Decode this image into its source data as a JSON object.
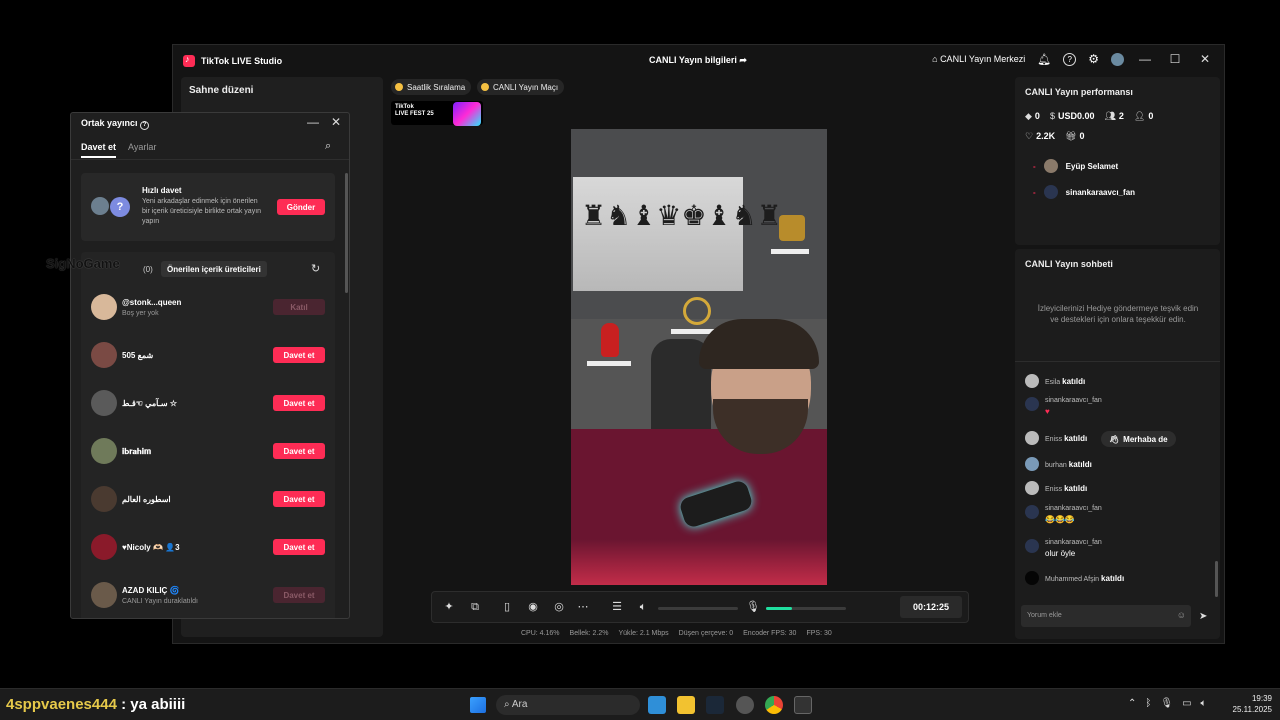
{
  "window": {
    "app_name": "TikTok LIVE Studio",
    "live_info": "CANLI Yayın bilgileri",
    "live_center": "CANLI Yayın Merkezi",
    "minimize": "—",
    "maximize": "☐",
    "close": "✕"
  },
  "left_panel": {
    "title": "Sahne düzeni"
  },
  "stage": {
    "chip_hourly": "Saatlik Sıralama",
    "chip_match": "CANLI Yayın Maçı",
    "livefest_line1": "TikTok",
    "livefest_line2": "LIVE FEST 25"
  },
  "controls": {
    "timer": "00:12:25",
    "volume_level": 0,
    "mic_level": 0.32
  },
  "stats": {
    "cpu": "CPU:  4.16%",
    "memory": "Bellek:  2.2%",
    "upload": "Yükle:  2.1 Mbps",
    "dropped": "Düşen çerçeve:  0",
    "encoder_fps": "Encoder FPS:  30",
    "fps": "FPS:  30"
  },
  "performance": {
    "title": "CANLI Yayın performansı",
    "diamonds": "0",
    "usd": "USD0.00",
    "viewers": "2",
    "new_followers": "0",
    "likes": "2.2K",
    "gifts": "0",
    "viewer_list": [
      "Eyüp Selamet",
      "sinankaraavcı_fan"
    ]
  },
  "chat": {
    "title": "CANLI Yayın sohbeti",
    "empty_text": "İzleyicilerinizi Hediye göndermeye teşvik edin ve destekleri için onlara teşekkür edin.",
    "joined": "katıldı",
    "messages": [
      {
        "user": "Esila",
        "text": ""
      },
      {
        "user": "sinankaraavcı_fan",
        "text": "♥"
      },
      {
        "user": "Eniss",
        "text": ""
      },
      {
        "user": "burhan",
        "text": ""
      },
      {
        "user": "Eniss",
        "text": ""
      },
      {
        "user": "sinankaraavcı_fan",
        "text": "😂😂😂"
      },
      {
        "user": "sinankaraavcı_fan",
        "text": "olur öyle"
      },
      {
        "user": "Muhammed Afşin",
        "text": ""
      }
    ],
    "wave_label": "Merhaba de",
    "comment_placeholder": "Yorum ekle"
  },
  "cohost": {
    "title": "Ortak yayıncı",
    "tab_invite": "Davet et",
    "tab_settings": "Ayarlar",
    "quick_title": "Hızlı davet",
    "quick_desc": "Yeni arkadaşlar edinmek için önerilen bir içerik üreticisiyle birlikte ortak yayın yapın",
    "send_label": "Gönder",
    "count_label": "(0)",
    "suggested_label": "Önerilen içerik üreticileri",
    "creators": [
      {
        "name": "@stonk...queen",
        "sub": "Boş yer yok",
        "btn": "Katıl",
        "disabled": true
      },
      {
        "name": "505 شمع",
        "sub": "",
        "btn": "Davet et",
        "disabled": false
      },
      {
        "name": "سـآمي ☜قـط ☆",
        "sub": "",
        "btn": "Davet et",
        "disabled": false
      },
      {
        "name": "𝐢𝐛𝐫𝐚𝐡𝐢𝐦",
        "sub": "",
        "btn": "Davet et",
        "disabled": false
      },
      {
        "name": "اسطوره العالم",
        "sub": "",
        "btn": "Davet et",
        "disabled": false
      },
      {
        "name": "♥Nicoly 🫶🏻  👤3",
        "sub": "",
        "btn": "Davet et",
        "disabled": false
      },
      {
        "name": "AZAD KILIÇ 🌀",
        "sub": "CANLI Yayın duraklatıldı",
        "btn": "Davet et",
        "disabled": true
      }
    ]
  },
  "watermark": "SigNoGame",
  "taskbar": {
    "username": "4sppvaenes444",
    "message": " : ya abiiii",
    "search": "Ara",
    "time": "19:39",
    "date": "25.11.2025"
  }
}
